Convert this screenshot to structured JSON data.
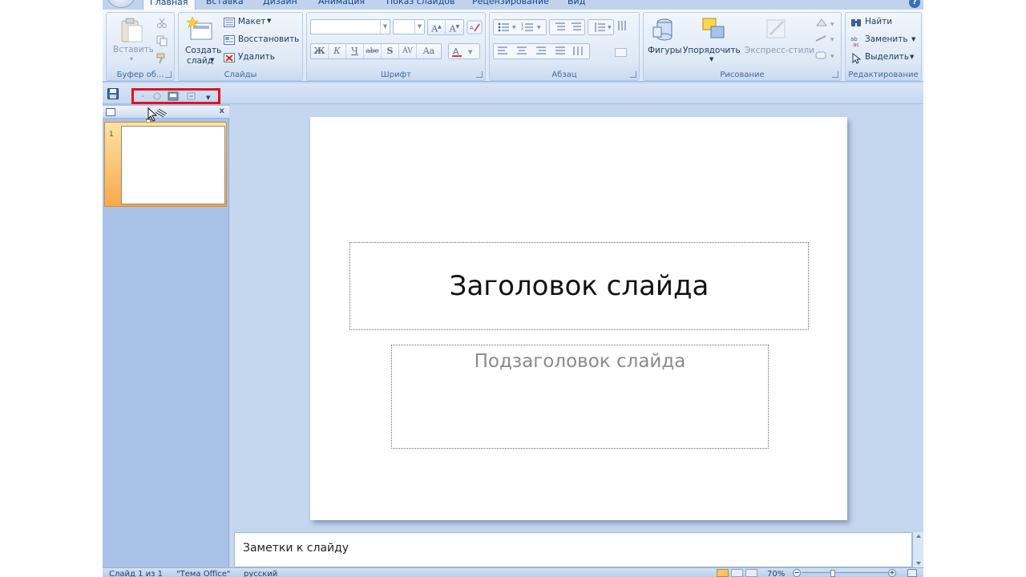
{
  "tabs": [
    "Главная",
    "Вставка",
    "Дизайн",
    "Анимация",
    "Показ слайдов",
    "Рецензирование",
    "Вид"
  ],
  "ribbon": {
    "clipboard": {
      "paste": "Вставить",
      "group_label": "Буфер об..."
    },
    "slides": {
      "new_slide_line1": "Создать",
      "new_slide_line2": "слайд",
      "layout": "Макет",
      "reset": "Восстановить",
      "delete": "Удалить",
      "group_label": "Слайды"
    },
    "font": {
      "group_label": "Шрифт",
      "bold": "Ж",
      "italic": "К",
      "underline": "Ч",
      "strike": "abc",
      "shadow": "S",
      "spacing": "AV",
      "case": "Aa"
    },
    "paragraph": {
      "group_label": "Абзац"
    },
    "drawing": {
      "shapes": "Фигуры",
      "arrange": "Упорядочить",
      "quick_styles": "Экспресс-стили",
      "group_label": "Рисование"
    },
    "editing": {
      "find": "Найти",
      "replace": "Заменить",
      "select": "Выделить",
      "group_label": "Редактирование"
    }
  },
  "slide_pane": {
    "slide_number": "1"
  },
  "slide": {
    "title": "Заголовок слайда",
    "subtitle": "Подзаголовок слайда"
  },
  "notes": {
    "placeholder": "Заметки к слайду"
  },
  "status": {
    "slide_info": "Слайд 1 из 1",
    "theme": "\"Тема Office\"",
    "language": "русский",
    "zoom": "70%"
  },
  "colors": {
    "highlight": "#e0141e",
    "ribbon_text": "#15428b",
    "selected_thumb": "#f7a94a"
  }
}
